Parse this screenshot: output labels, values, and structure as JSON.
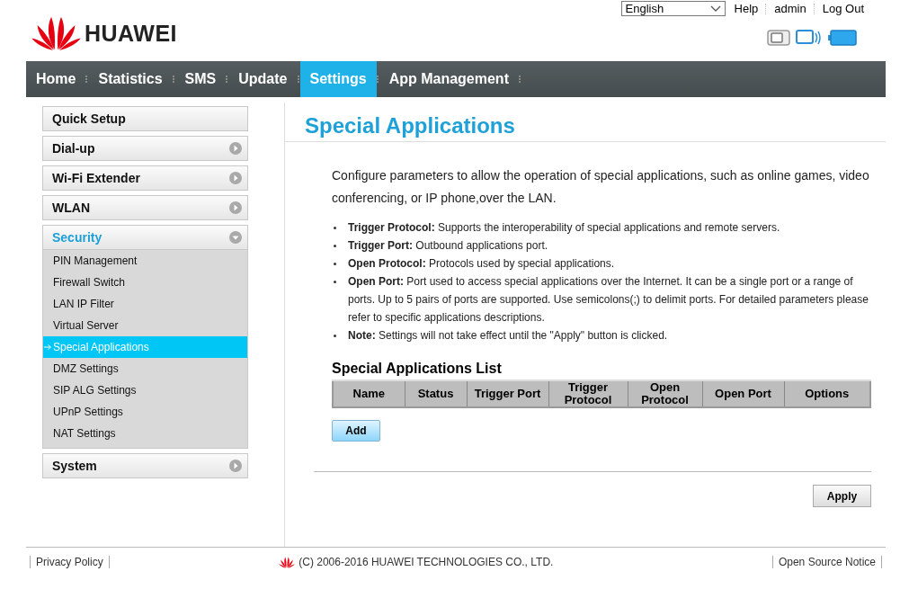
{
  "header": {
    "logo": "HUAWEI",
    "language": "English",
    "links": [
      "Help",
      "admin",
      "Log Out"
    ]
  },
  "nav": [
    {
      "label": "Home",
      "selected": false
    },
    {
      "label": "Statistics",
      "selected": false
    },
    {
      "label": "SMS",
      "selected": false
    },
    {
      "label": "Update",
      "selected": false
    },
    {
      "label": "Settings",
      "selected": true
    },
    {
      "label": "App Management",
      "selected": false
    }
  ],
  "sidebar": {
    "items": [
      {
        "label": "Quick Setup",
        "kind": "plain",
        "expanded": false
      },
      {
        "label": "Dial-up",
        "kind": "group",
        "expanded": false
      },
      {
        "label": "Wi-Fi Extender",
        "kind": "group",
        "expanded": false
      },
      {
        "label": "WLAN",
        "kind": "group",
        "expanded": false
      },
      {
        "label": "Security",
        "kind": "group",
        "expanded": true,
        "children": [
          {
            "label": "PIN Management",
            "selected": false
          },
          {
            "label": "Firewall Switch",
            "selected": false
          },
          {
            "label": "LAN IP Filter",
            "selected": false
          },
          {
            "label": "Virtual Server",
            "selected": false
          },
          {
            "label": "Special Applications",
            "selected": true
          },
          {
            "label": "DMZ Settings",
            "selected": false
          },
          {
            "label": "SIP ALG Settings",
            "selected": false
          },
          {
            "label": "UPnP Settings",
            "selected": false
          },
          {
            "label": "NAT Settings",
            "selected": false
          }
        ]
      },
      {
        "label": "System",
        "kind": "group",
        "expanded": false
      }
    ]
  },
  "main": {
    "title": "Special Applications",
    "intro": "Configure parameters to allow the operation of special applications, such as online games, video conferencing, or IP phone,over the LAN.",
    "bullets": [
      "**Trigger Protocol:** Supports the interoperability of special applications and remote servers.",
      "**Trigger Port:** Outbound applications port.",
      "**Open Protocol:** Protocols used by special applications.",
      "**Open Port:** Port used to access special applications over the Internet. It can be a single port or a range of ports. Up to 5 pairs of ports are supported. Use semicolons(;) to delimit ports. For detailed parameters please refer to specific applications descriptions.",
      "**Note:** Settings will not take effect until the \"Apply\" button is clicked."
    ],
    "list_title": "Special Applications List",
    "columns": [
      "Name",
      "Status",
      "Trigger Port",
      "Trigger Protocol",
      "Open Protocol",
      "Open Port",
      "Options"
    ],
    "add_button": "Add",
    "apply_button": "Apply"
  },
  "footer": {
    "left_link": "Privacy Policy",
    "copyright": "(C) 2006-2016 HUAWEI TECHNOLOGIES CO., LTD.",
    "right_link": "Open Source Notice"
  }
}
